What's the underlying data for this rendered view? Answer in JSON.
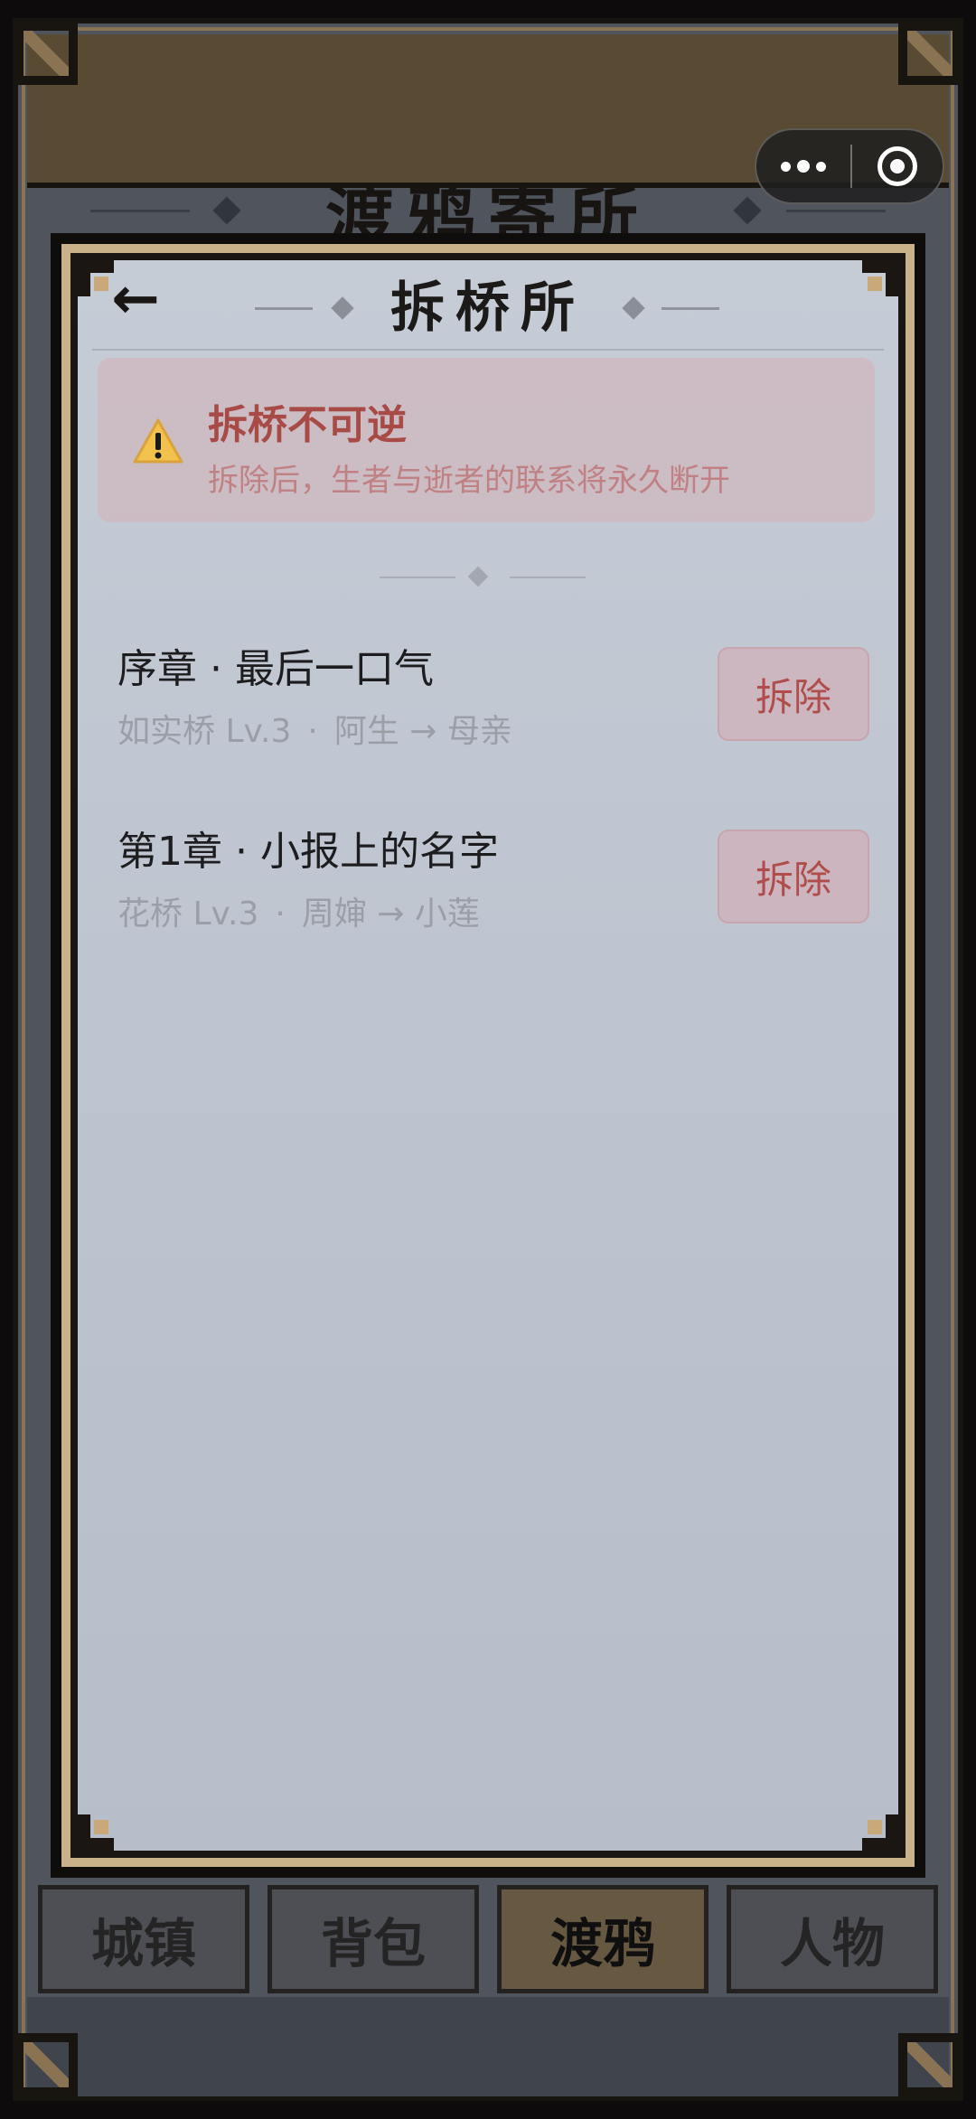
{
  "background": {
    "title": "渡鸦寄所",
    "tabs": [
      {
        "label": "城镇",
        "active": false
      },
      {
        "label": "背包",
        "active": false
      },
      {
        "label": "渡鸦",
        "active": true
      },
      {
        "label": "人物",
        "active": false
      }
    ]
  },
  "capsule": {
    "more_icon": "more-dots-icon",
    "close_icon": "target-circle-icon"
  },
  "modal": {
    "back_icon": "back-arrow-icon",
    "back_glyph": "←",
    "title": "拆桥所",
    "warning": {
      "icon": "warning-triangle-icon",
      "title": "拆桥不可逆",
      "text": "拆除后，生者与逝者的联系将永久断开"
    },
    "bridges": [
      {
        "chapter": "序章 · 最后一口气",
        "bridge": "如实桥 Lv.3",
        "from": "阿生",
        "arrow": "→",
        "to": "母亲",
        "action": "拆除"
      },
      {
        "chapter": "第1章 · 小报上的名字",
        "bridge": "花桥 Lv.3",
        "from": "周婶",
        "arrow": "→",
        "to": "小莲",
        "action": "拆除"
      }
    ]
  },
  "colors": {
    "accent_red": "#b04d4b",
    "frame_gold": "#c9b28a",
    "panel_bg": "#c6ccd6"
  }
}
